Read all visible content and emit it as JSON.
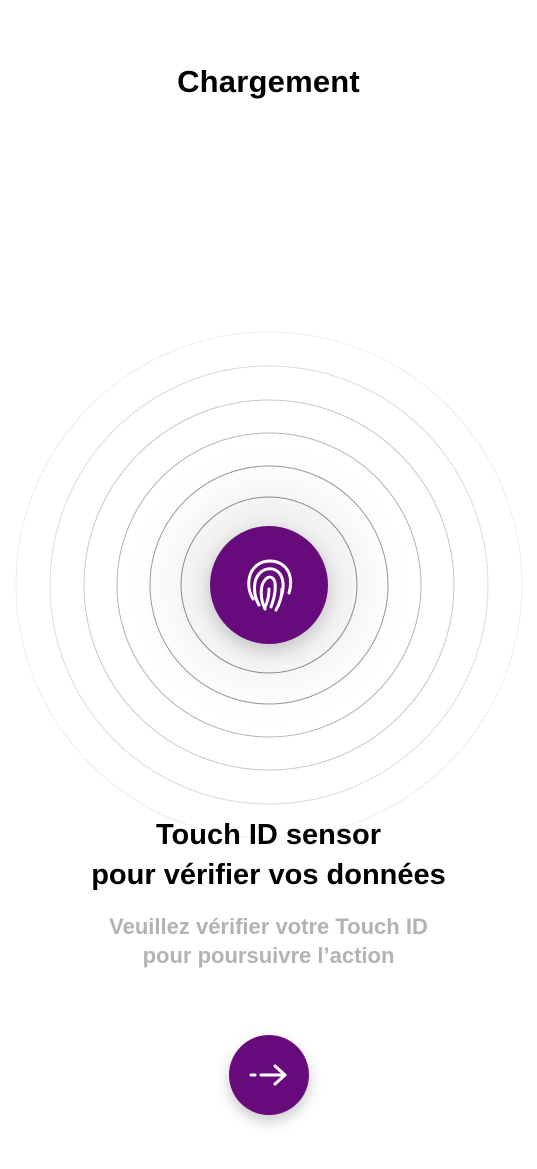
{
  "header": {
    "title": "Chargement"
  },
  "sensor": {
    "icon": "fingerprint-icon",
    "accent_color": "#660a7c"
  },
  "message": {
    "headline_line1": "Touch ID sensor",
    "headline_line2": "pour vérifier vos données",
    "sub_line1": "Veuillez vérifier votre Touch ID",
    "sub_line2": "pour poursuivre l’action"
  },
  "actions": {
    "next_icon": "arrow-right-icon"
  }
}
